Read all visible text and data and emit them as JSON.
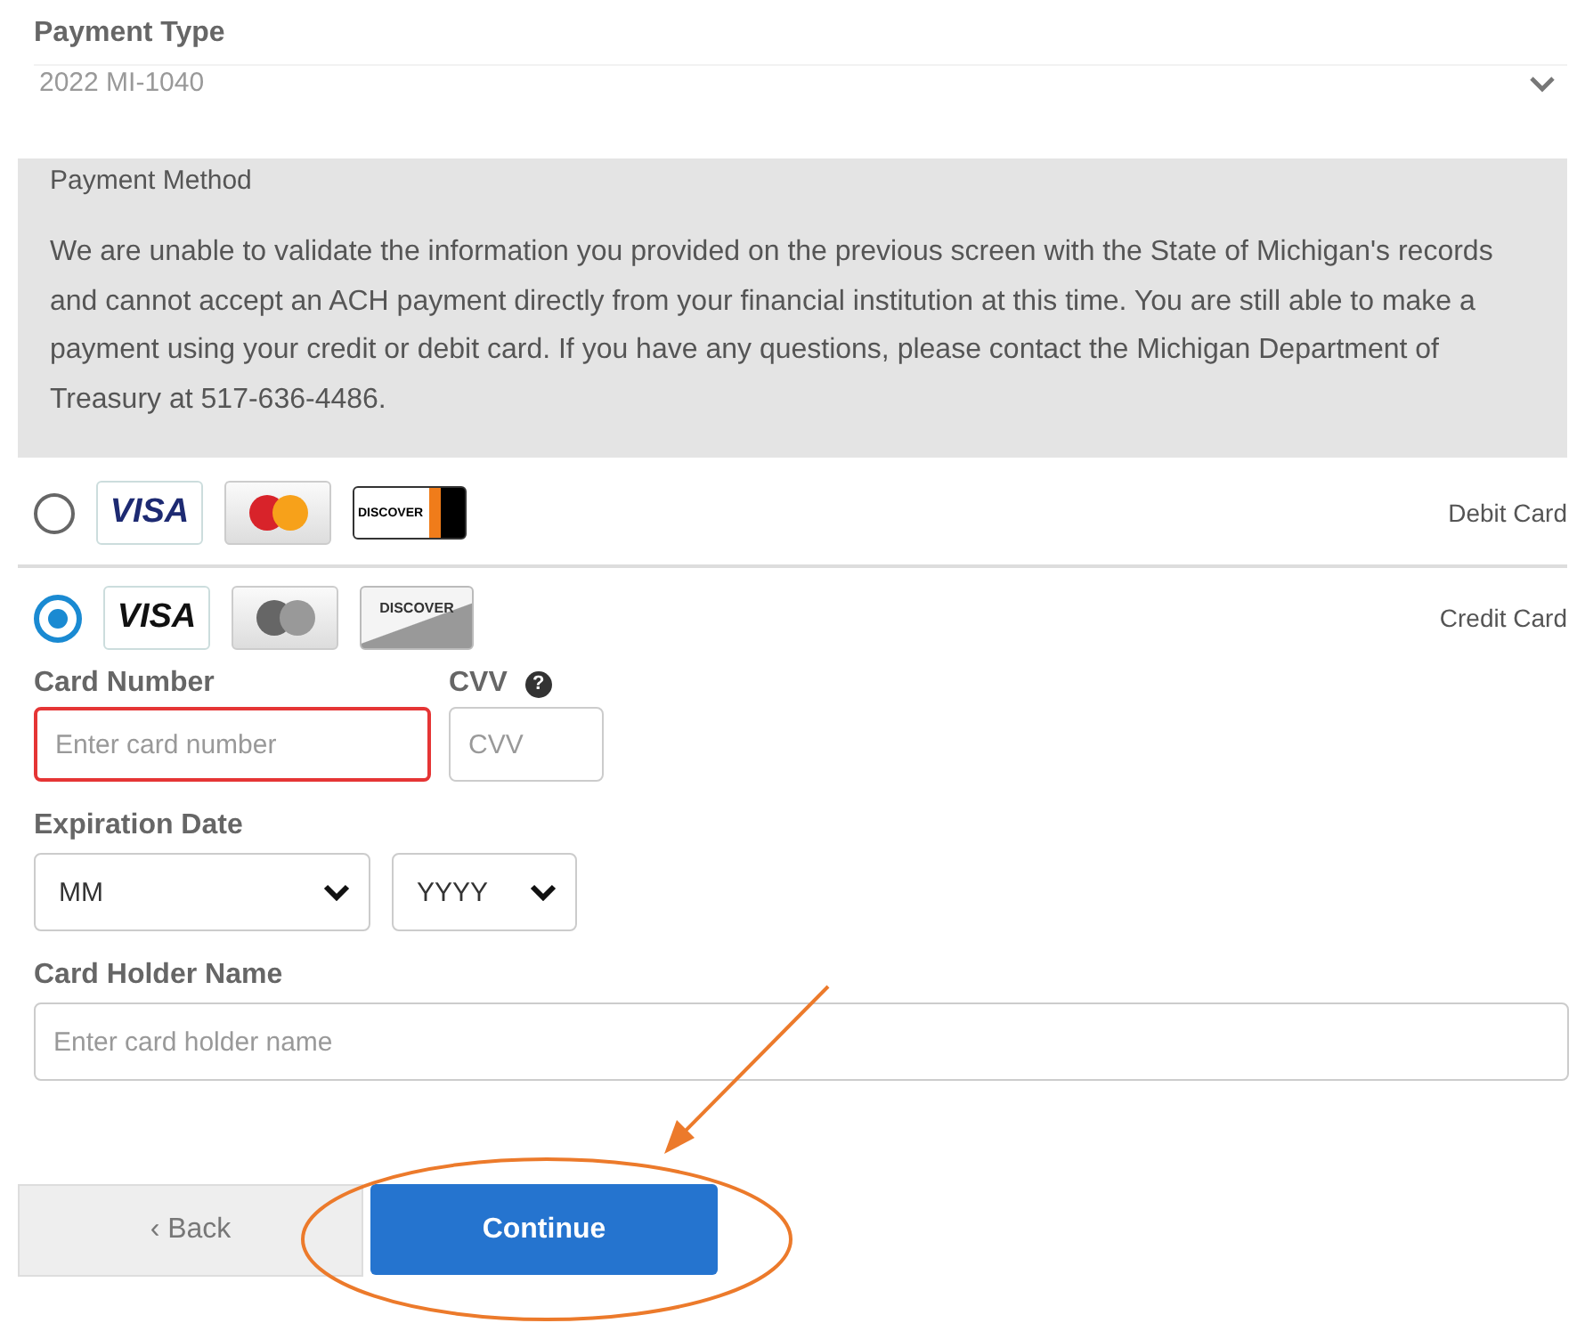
{
  "payment_type": {
    "label": "Payment Type",
    "value": "2022 MI-1040"
  },
  "payment_method": {
    "title": "Payment Method",
    "message": "We are unable to validate the information you provided on the previous screen with the State of Michigan's records and cannot accept an ACH payment directly from your financial institution at this time. You are still able to make a payment using your credit or debit card. If you have any questions, please contact the Michigan Department of Treasury at 517-636-4486."
  },
  "card_options": [
    {
      "label": "Debit Card",
      "selected": false,
      "logos": [
        {
          "kind": "visa",
          "text": "VISA"
        },
        {
          "kind": "mastercard"
        },
        {
          "kind": "discover-debit",
          "text": "DISCOVER"
        }
      ]
    },
    {
      "label": "Credit Card",
      "selected": true,
      "logos": [
        {
          "kind": "visa",
          "text": "VISA"
        },
        {
          "kind": "mastercard"
        },
        {
          "kind": "discover",
          "text": "DISCOVER"
        }
      ]
    }
  ],
  "card_number": {
    "label": "Card Number",
    "placeholder": "Enter card number",
    "invalid": true
  },
  "cvv": {
    "label": "CVV",
    "placeholder": "CVV",
    "help_icon": "?"
  },
  "expiration": {
    "label": "Expiration Date",
    "month": "MM",
    "year": "YYYY"
  },
  "holder": {
    "label": "Card Holder Name",
    "placeholder": "Enter card holder name"
  },
  "buttons": {
    "back": "‹ Back",
    "continue": "Continue"
  }
}
